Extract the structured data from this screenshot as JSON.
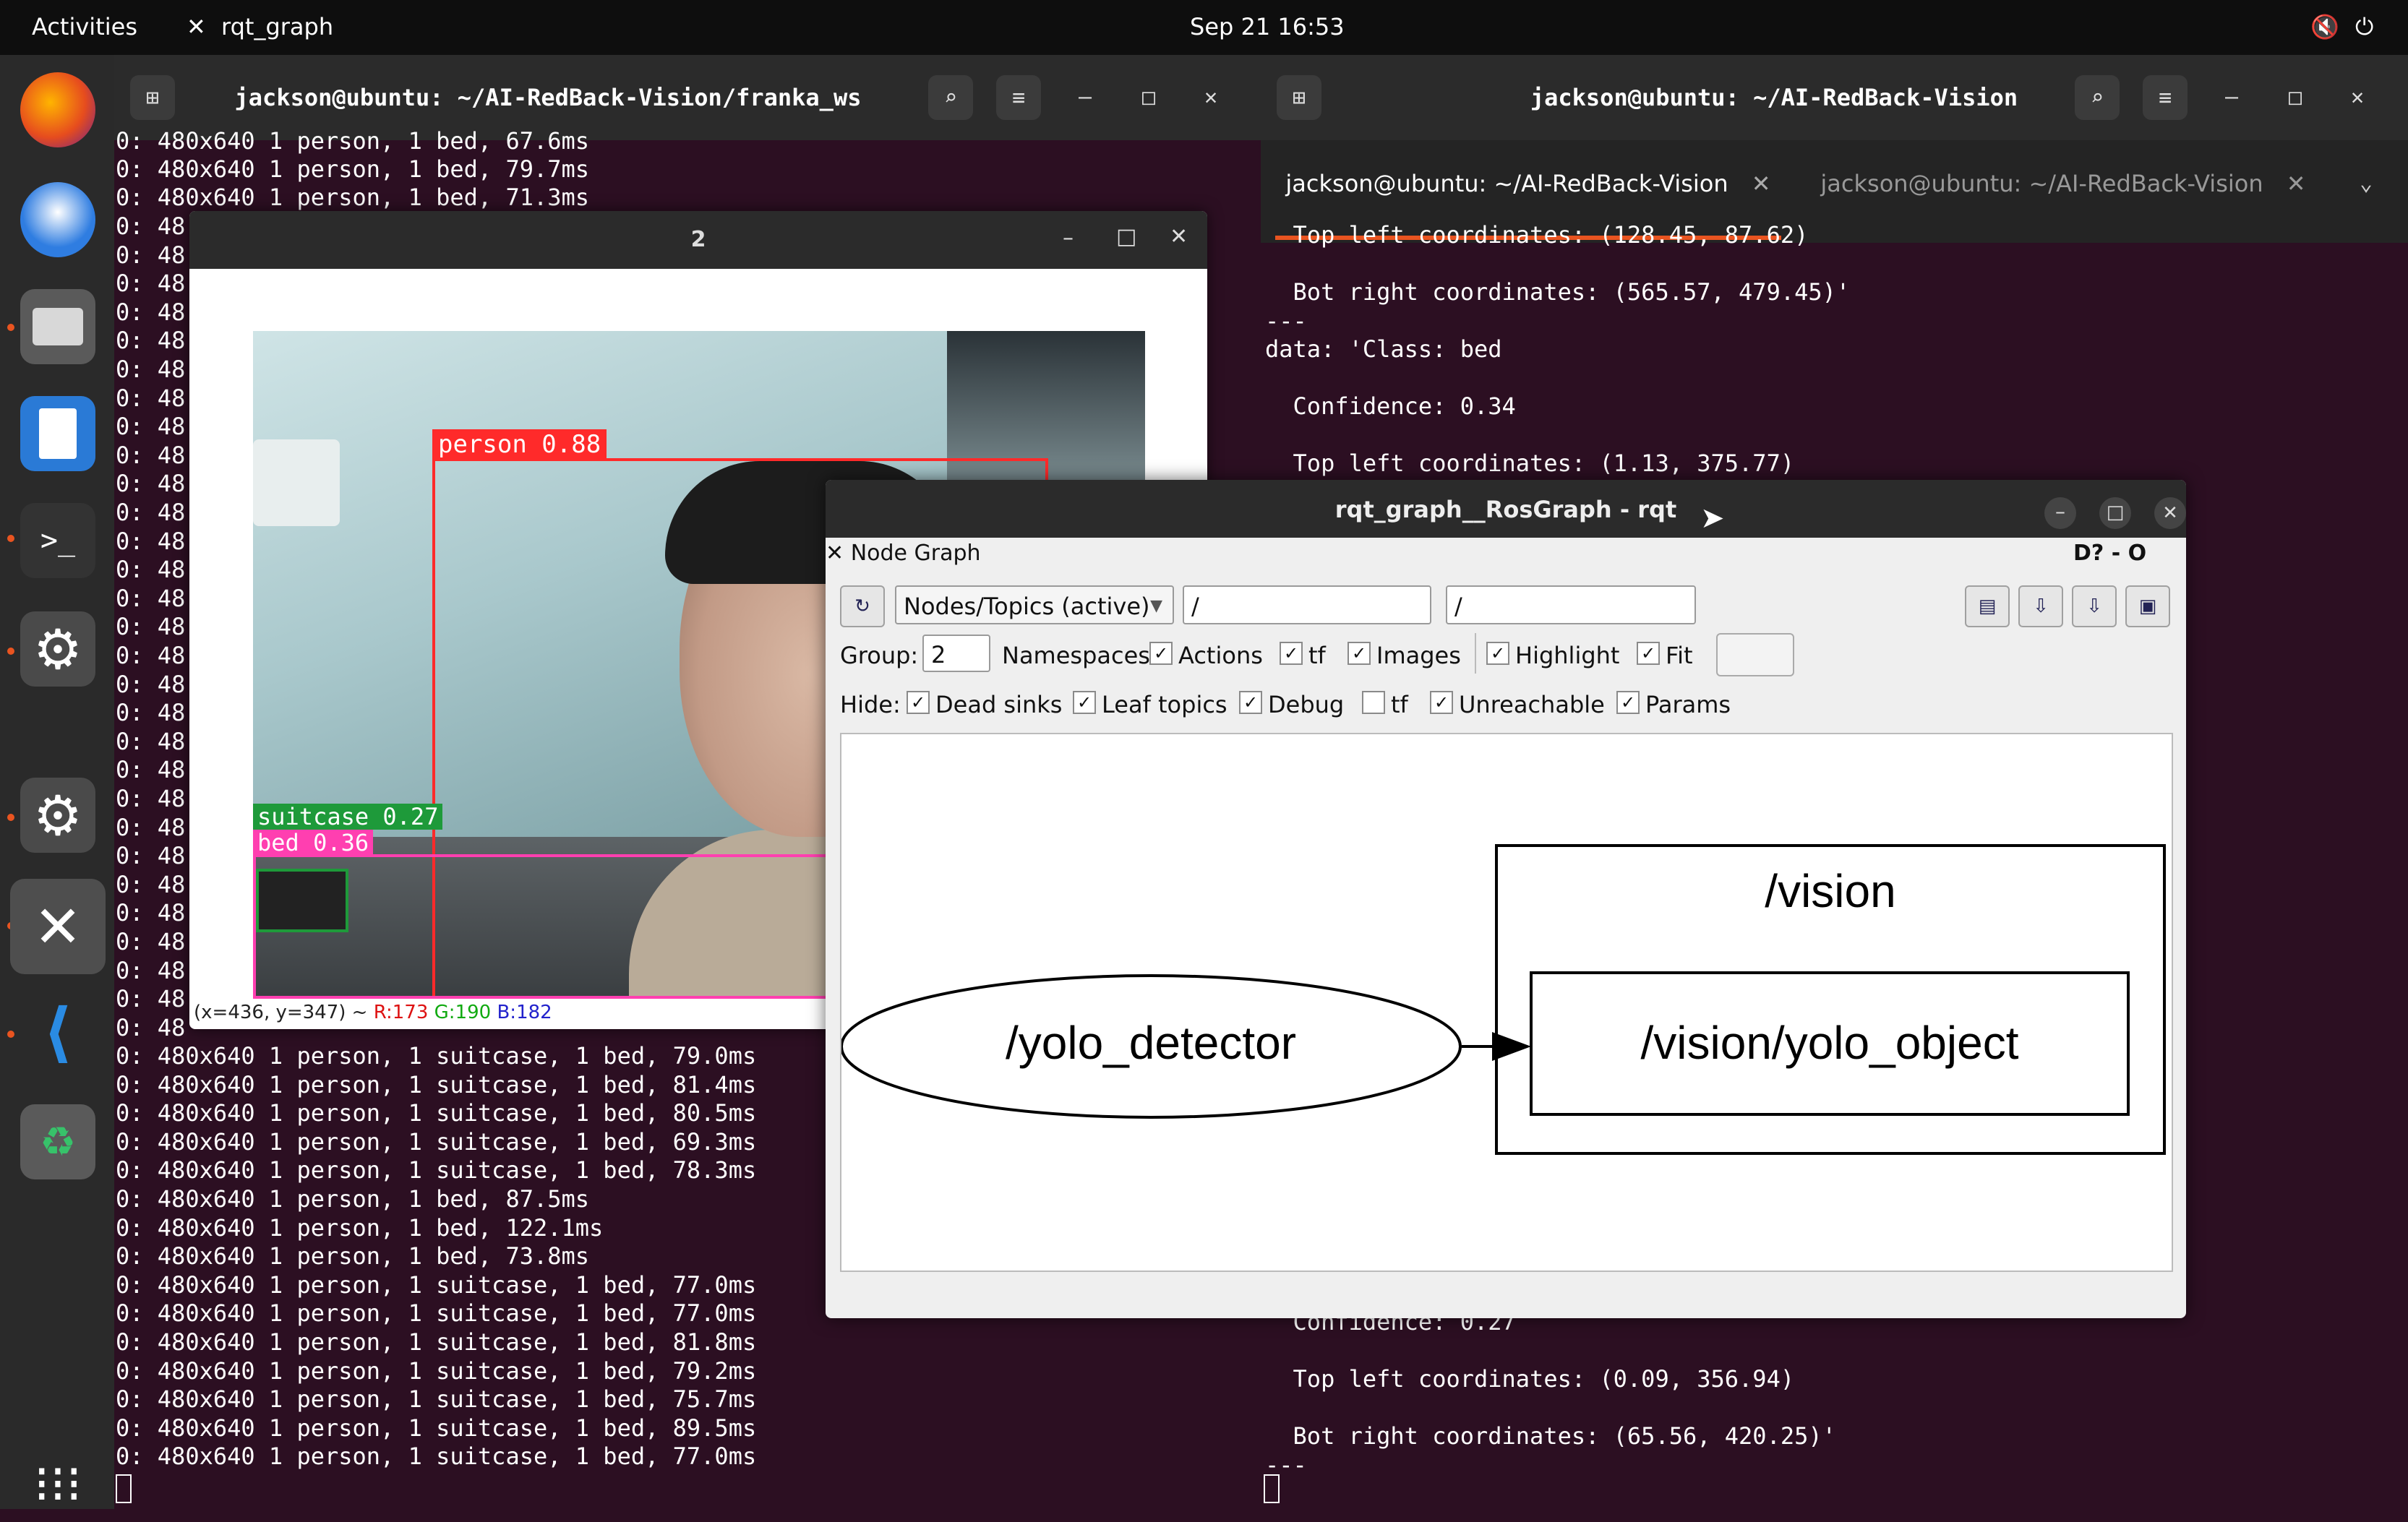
{
  "topbar": {
    "activities": "Activities",
    "app_name": "rqt_graph",
    "clock": "Sep 21  16:53"
  },
  "dock": {
    "icons": [
      "firefox-icon",
      "thunderbird-icon",
      "files-icon",
      "writer-icon",
      "terminal-icon",
      "settings-icon",
      "settings-icon",
      "rqt-tools-icon",
      "vscode-icon",
      "trash-icon",
      "app-grid-icon"
    ]
  },
  "left_terminal": {
    "title": "jackson@ubuntu: ~/AI-RedBack-Vision/franka_ws",
    "top_lines": [
      "0: 480x640 1 person, 1 bed, 67.6ms",
      "0: 480x640 1 person, 1 bed, 79.7ms",
      "0: 480x640 1 person, 1 bed, 71.3ms"
    ],
    "partial_prefix": "0: 48",
    "bottom_lines": [
      "0: 480x640 1 person, 1 suitcase, 1 bed, 79.0ms",
      "0: 480x640 1 person, 1 suitcase, 1 bed, 81.4ms",
      "0: 480x640 1 person, 1 suitcase, 1 bed, 80.5ms",
      "0: 480x640 1 person, 1 suitcase, 1 bed, 69.3ms",
      "0: 480x640 1 person, 1 suitcase, 1 bed, 78.3ms",
      "0: 480x640 1 person, 1 bed, 87.5ms",
      "0: 480x640 1 person, 1 bed, 122.1ms",
      "0: 480x640 1 person, 1 bed, 73.8ms",
      "0: 480x640 1 person, 1 suitcase, 1 bed, 77.0ms",
      "0: 480x640 1 person, 1 suitcase, 1 bed, 77.0ms",
      "0: 480x640 1 person, 1 suitcase, 1 bed, 81.8ms",
      "0: 480x640 1 person, 1 suitcase, 1 bed, 79.2ms",
      "0: 480x640 1 person, 1 suitcase, 1 bed, 75.7ms",
      "0: 480x640 1 person, 1 suitcase, 1 bed, 89.5ms",
      "0: 480x640 1 person, 1 suitcase, 1 bed, 77.0ms"
    ]
  },
  "right_terminal": {
    "title": "jackson@ubuntu: ~/AI-RedBack-Vision",
    "tabs": [
      "jackson@ubuntu: ~/AI-RedBack-Vision",
      "jackson@ubuntu: ~/AI-RedBack-Vision"
    ],
    "lines_top": [
      "  Top left coordinates: (128.45, 87.62)",
      "",
      "  Bot right coordinates: (565.57, 479.45)'",
      "---",
      "data: 'Class: bed",
      "",
      "  Confidence: 0.34",
      "",
      "  Top left coordinates: (1.13, 375.77)"
    ],
    "lines_bottom": [
      "  Confidence: 0.27",
      "",
      "  Top left coordinates: (0.09, 356.94)",
      "",
      "  Bot right coordinates: (65.56, 420.25)'",
      "---"
    ]
  },
  "image_window": {
    "title": "2",
    "detections": [
      {
        "label": "person 0.88",
        "color": "#ff2a2a"
      },
      {
        "label": "suitcase 0.27",
        "color": "#1e9a3a"
      },
      {
        "label": "bed 0.36",
        "color": "#ff3fb0"
      }
    ],
    "status_prefix": "(x=436, y=347) ~ ",
    "status_r": "R:173",
    "status_g": "G:190",
    "status_b": "B:182"
  },
  "rqt": {
    "title": "rqt_graph__RosGraph - rqt",
    "plugin_title": "Node Graph",
    "plugin_controls": "D?  - O",
    "mode": "Nodes/Topics (active)",
    "filter1": "/",
    "filter2": "/",
    "group_label": "Group:",
    "group_value": "2",
    "row1": [
      "Namespaces",
      "Actions",
      "tf",
      "Images",
      "Highlight",
      "Fit"
    ],
    "hide_label": "Hide:",
    "row2": [
      "Dead sinks",
      "Leaf topics",
      "Debug",
      "tf",
      "Unreachable",
      "Params"
    ],
    "graph": {
      "namespace": "/vision",
      "node": "/yolo_detector",
      "topic": "/vision/yolo_object"
    }
  }
}
